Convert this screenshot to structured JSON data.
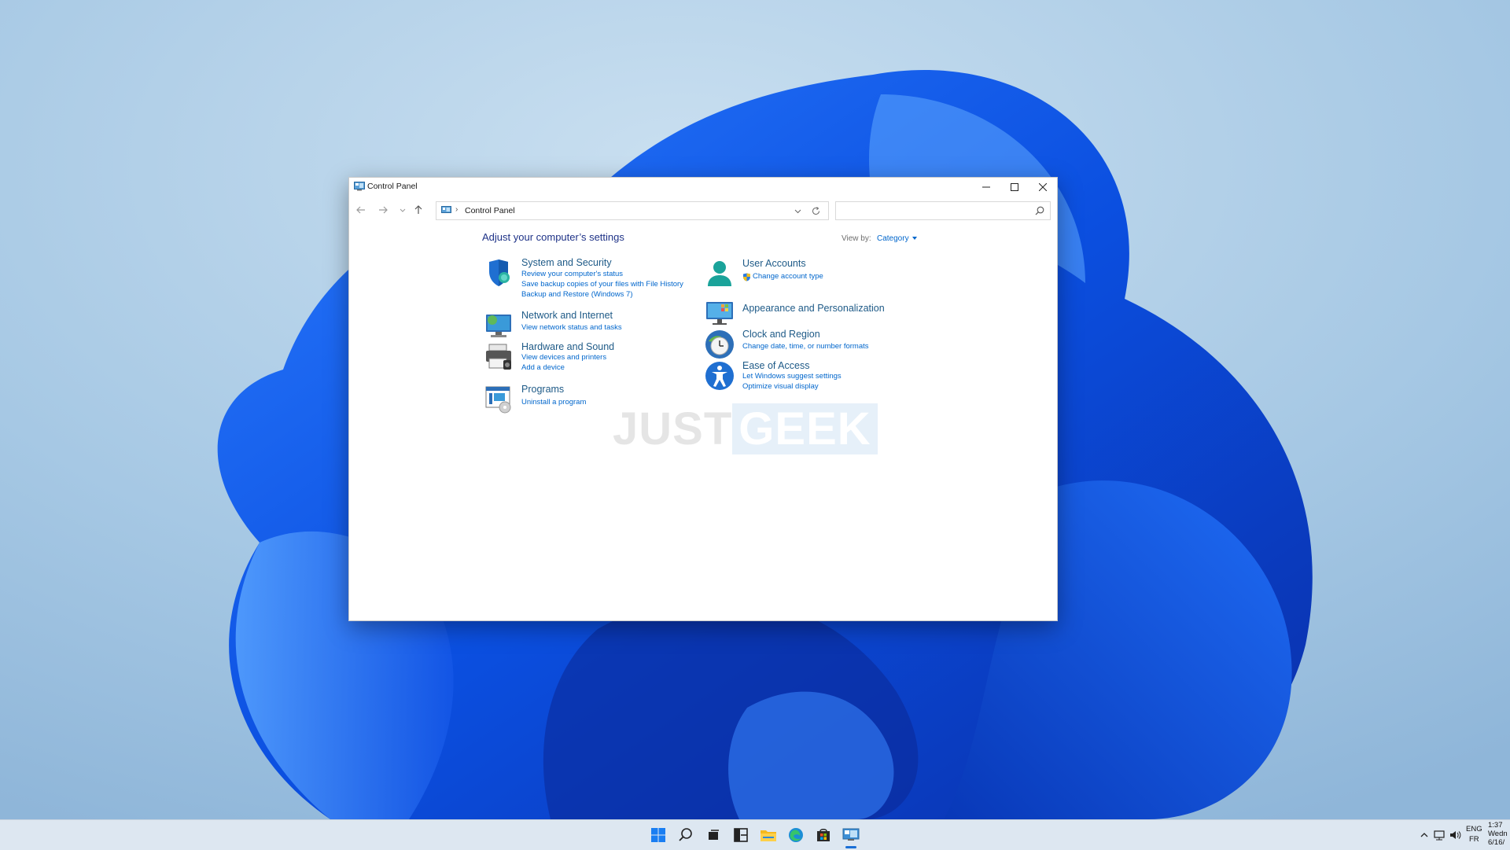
{
  "window": {
    "title": "Control Panel",
    "minimize_icon": "minimize-icon",
    "maximize_icon": "maximize-icon",
    "close_icon": "close-icon"
  },
  "nav": {
    "address": "Control Panel",
    "separator": "›",
    "search_placeholder": ""
  },
  "page": {
    "heading": "Adjust your computer’s settings",
    "view_by_label": "View by:",
    "view_by_value": "Category"
  },
  "categories": {
    "system": {
      "title": "System and Security",
      "links": [
        "Review your computer's status",
        "Save backup copies of your files with File History",
        "Backup and Restore (Windows 7)"
      ],
      "icon": "shield-icon"
    },
    "network": {
      "title": "Network and Internet",
      "links": [
        "View network status and tasks"
      ],
      "icon": "network-icon"
    },
    "hardware": {
      "title": "Hardware and Sound",
      "links": [
        "View devices and printers",
        "Add a device"
      ],
      "icon": "printer-icon"
    },
    "programs": {
      "title": "Programs",
      "links": [
        "Uninstall a program"
      ],
      "icon": "programs-icon"
    },
    "users": {
      "title": "User Accounts",
      "links": [
        "Change account type"
      ],
      "icon": "user-icon"
    },
    "appearance": {
      "title": "Appearance and Personalization",
      "links": [],
      "icon": "monitor-icon"
    },
    "clock": {
      "title": "Clock and Region",
      "links": [
        "Change date, time, or number formats"
      ],
      "icon": "clock-icon"
    },
    "ease": {
      "title": "Ease of Access",
      "links": [
        "Let Windows suggest settings",
        "Optimize visual display"
      ],
      "icon": "accessibility-icon"
    }
  },
  "watermark": {
    "part1": "JUST",
    "part2": "GEEK"
  },
  "taskbar": {
    "apps": [
      "start-icon",
      "search-icon",
      "task-view-icon",
      "widgets-icon",
      "file-explorer-icon",
      "edge-icon",
      "store-icon",
      "control-panel-icon"
    ],
    "lang_line1": "ENG",
    "lang_line2": "FR",
    "clock_line1": "1:37",
    "clock_line2": "Wedn",
    "clock_line3": "6/16/"
  },
  "colors": {
    "link": "#0066cc",
    "category_title": "#1e5a87",
    "heading": "#1e3287",
    "taskbar": "#dde7f1"
  }
}
